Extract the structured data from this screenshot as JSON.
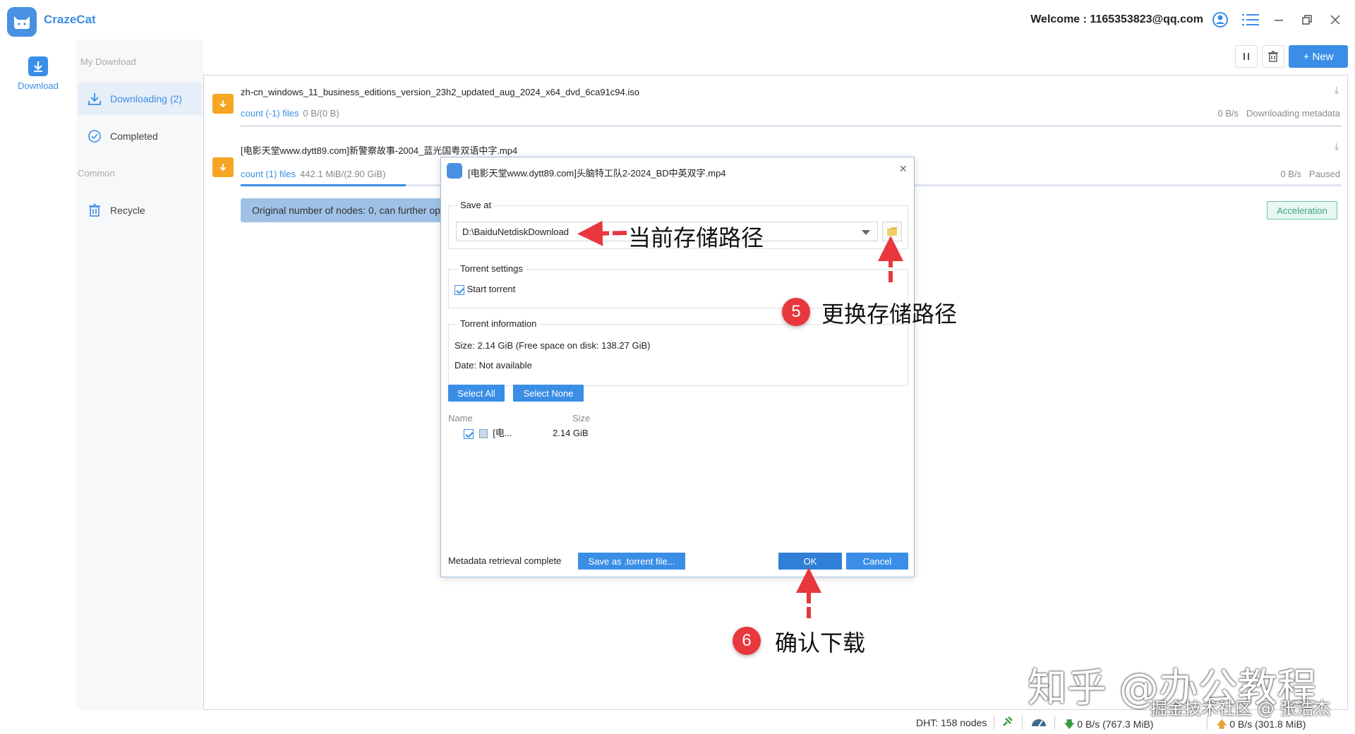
{
  "app": {
    "name": "CrazeCat",
    "brand_color": "#3a8ee6"
  },
  "titlebar": {
    "welcome": "Welcome : 1165353823@qq.com",
    "icons": [
      "user-icon",
      "menu-list-icon",
      "minimize-icon",
      "restore-icon",
      "close-icon"
    ]
  },
  "rail": {
    "download_label": "Download"
  },
  "sidebar": {
    "my_download_label": "My Download",
    "downloading_label": "Downloading (2)",
    "completed_label": "Completed",
    "common_label": "Common",
    "recycle_label": "Recycle"
  },
  "toolbar": {
    "new_label": "+ New"
  },
  "tasks": [
    {
      "name": "zh-cn_windows_11_business_editions_version_23h2_updated_aug_2024_x64_dvd_6ca91c94.iso",
      "count": "count (-1) files",
      "size": "0 B/(0 B)",
      "speed": "0 B/s",
      "status": "Downloading metadata"
    },
    {
      "name": "[电影天堂www.dytt89.com]新警察故事-2004_蓝光国粤双语中字.mp4",
      "count": "count (1) files",
      "size": "442.1 MiB/(2.90 GiB)",
      "speed": "0 B/s",
      "status": "Paused",
      "progress": 0.15
    }
  ],
  "message": "Original number of nodes: 0, can further op",
  "acceleration_label": "Acceleration",
  "dialog": {
    "title": "[电影天堂www.dytt89.com]头脑特工队2-2024_BD中英双字.mp4",
    "save_at_label": "Save at",
    "save_path": "D:\\BaiduNetdiskDownload",
    "torrent_settings_label": "Torrent settings",
    "start_torrent_label": "Start torrent",
    "torrent_info_label": "Torrent information",
    "size_line": "Size:   2.14 GiB (Free space on disk: 138.27 GiB)",
    "date_line": "Date:  Not available",
    "select_all": "Select All",
    "select_none": "Select None",
    "col_name": "Name",
    "col_size": "Size",
    "file_name": "[电...",
    "file_size": "2.14 GiB",
    "metadata_status": "Metadata retrieval complete",
    "save_torrent": "Save as .torrent file...",
    "ok": "OK",
    "cancel": "Cancel"
  },
  "annotations": {
    "current_path": "当前存储路径",
    "step5_num": "5",
    "step5_text": "更换存储路径",
    "step6_num": "6",
    "step6_text": "确认下载"
  },
  "statusbar": {
    "dht": "DHT: 158 nodes",
    "down": "0 B/s (767.3 MiB)",
    "up": "0 B/s (301.8 MiB)"
  },
  "watermark": {
    "line1": "知乎 @办公教程",
    "line2": "掘金技术社区 @ 张浩杰"
  }
}
